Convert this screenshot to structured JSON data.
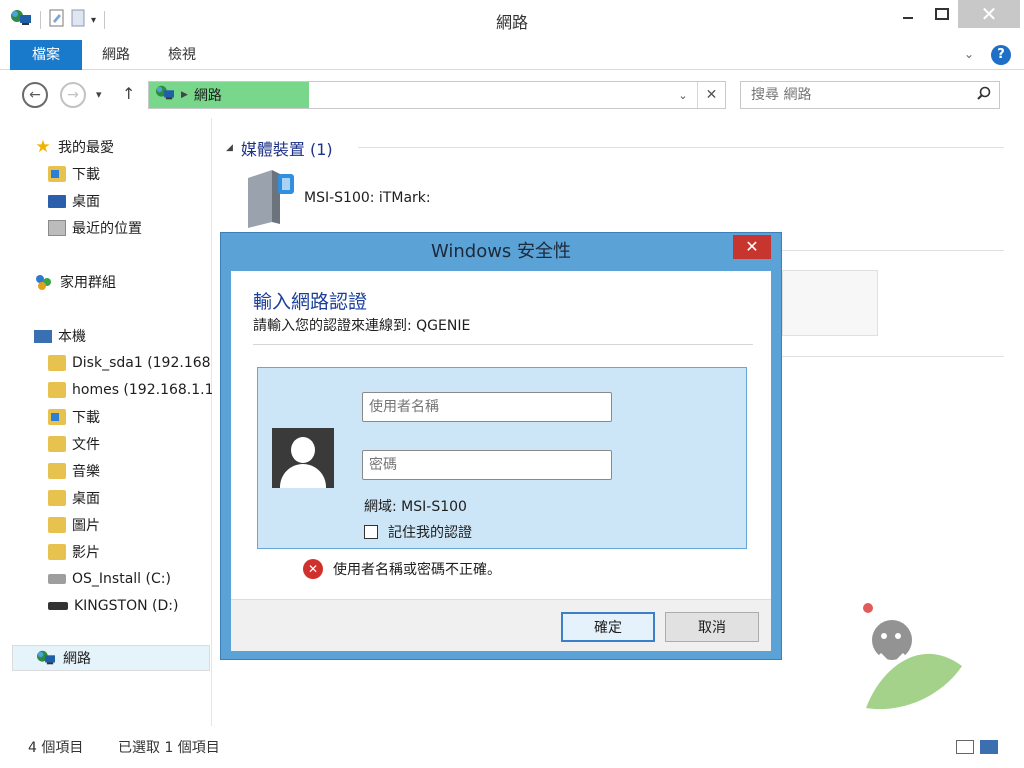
{
  "window": {
    "title": "網路"
  },
  "ribbon": {
    "tabs": [
      "檔案",
      "網路",
      "檢視"
    ],
    "help": "?"
  },
  "address": {
    "location": "網路"
  },
  "search": {
    "placeholder": "搜尋 網路"
  },
  "nav_pane": {
    "favorites": {
      "label": "我的最愛",
      "items": [
        "下載",
        "桌面",
        "最近的位置"
      ]
    },
    "homegroup": {
      "label": "家用群組"
    },
    "this_pc": {
      "label": "本機",
      "items": [
        "Disk_sda1 (192.168",
        "homes (192.168.1.1",
        "下載",
        "文件",
        "音樂",
        "桌面",
        "圖片",
        "影片",
        "OS_Install (C:)",
        "KINGSTON (D:)"
      ]
    },
    "network": {
      "label": "網路"
    }
  },
  "content": {
    "section_title": "媒體裝置 (1)",
    "device_name": "MSI-S100: iTMark:"
  },
  "status_bar": {
    "item_count": "4 個項目",
    "selected": "已選取 1 個項目"
  },
  "dialog": {
    "title": "Windows 安全性",
    "heading": "輸入網路認證",
    "subtitle": "請輸入您的認證來連線到: QGENIE",
    "username_placeholder": "使用者名稱",
    "password_placeholder": "密碼",
    "domain": "網域: MSI-S100",
    "remember_label": "記住我的認證",
    "error_message": "使用者名稱或密碼不正確。",
    "ok_label": "確定",
    "cancel_label": "取消"
  },
  "colors": {
    "accent": "#1979ca",
    "address_highlight": "#78d78a",
    "dialog_frame": "#5ba2d7",
    "dialog_close": "#c7362e",
    "credential_panel": "#cde6f7",
    "heading_blue": "#1c3f9c"
  }
}
